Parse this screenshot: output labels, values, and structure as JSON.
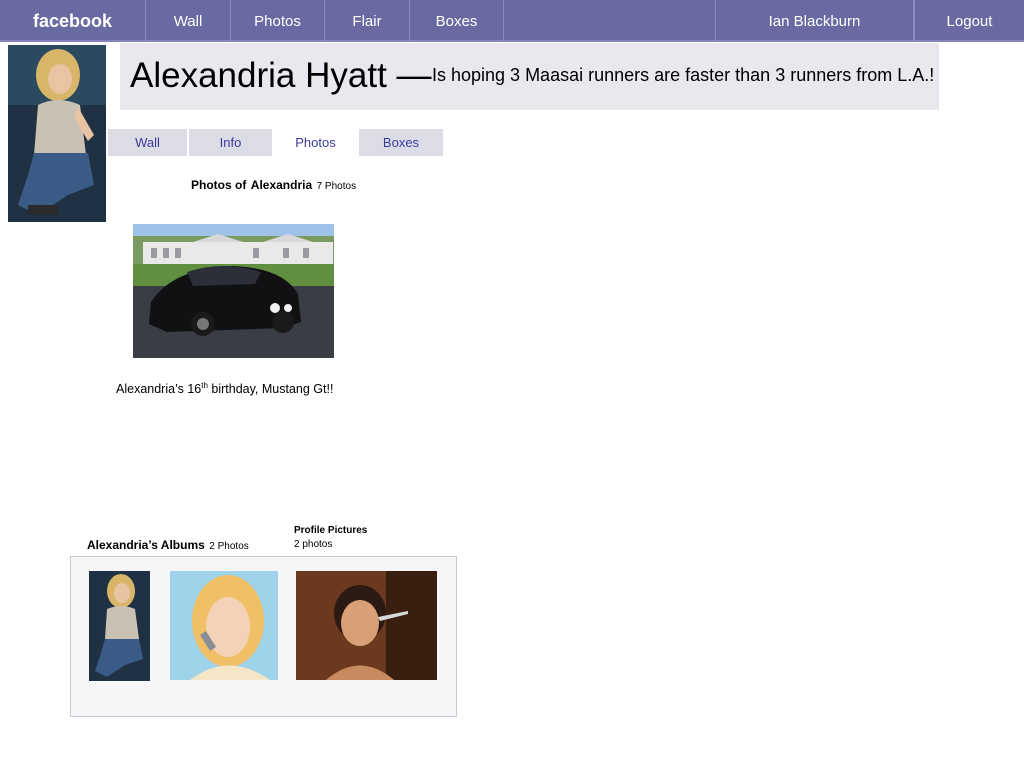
{
  "topbar": {
    "logo": "facebook",
    "nav": [
      "Wall",
      "Photos",
      "Flair",
      "Boxes"
    ],
    "user": "Ian Blackburn",
    "logout": "Logout",
    "bg_color": "#6a6aa2"
  },
  "profile": {
    "name": "Alexandria Hyatt",
    "dash": "—",
    "status": "Is hoping 3 Maasai runners are faster than 3 runners from L.A.!"
  },
  "tabs": [
    "Wall",
    "Info",
    "Photos",
    "Boxes"
  ],
  "active_tab": "Photos",
  "photos": {
    "heading_prefix": "Photos of",
    "heading_name": "Alexandria",
    "count": "7 Photos",
    "caption_before": "Alexandria’s 16",
    "caption_sup": "th",
    "caption_after": " birthday, Mustang Gt!!"
  },
  "albums": {
    "heading": "Alexandria’s Albums",
    "count": "2 Photos",
    "profile_pictures_label": "Profile Pictures",
    "profile_pictures_count": "2 photos"
  }
}
